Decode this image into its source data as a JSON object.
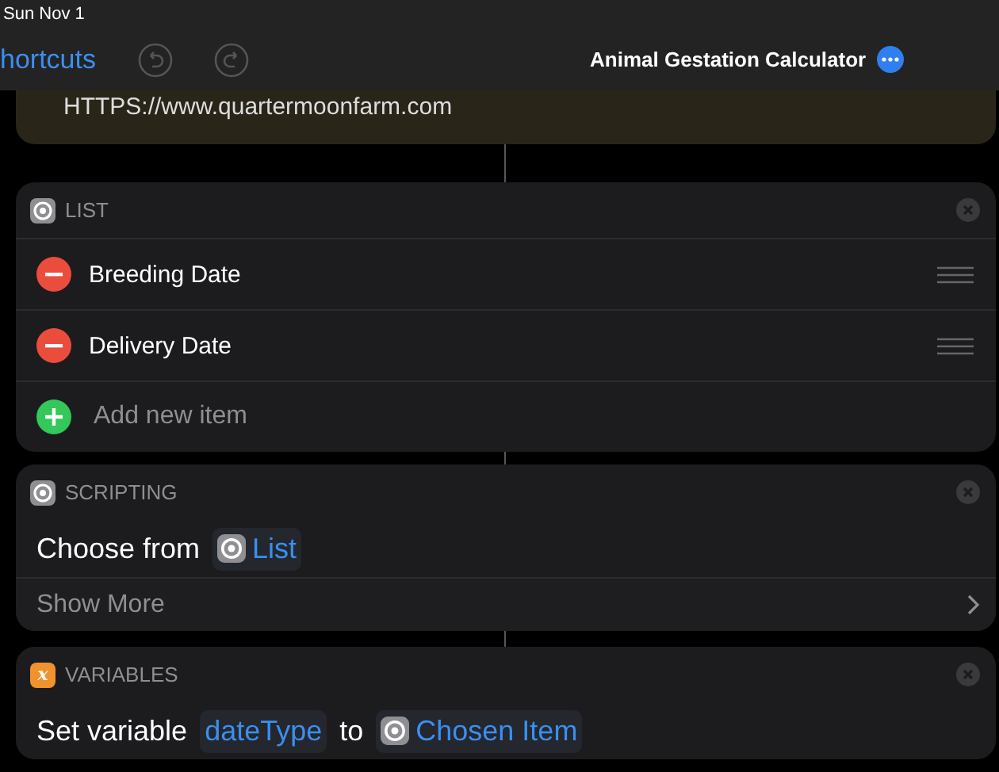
{
  "status_bar": {
    "date": "Sun Nov 1"
  },
  "nav": {
    "back": "hortcuts",
    "title": "Animal Gestation Calculator"
  },
  "actions": [
    {
      "kind": "text",
      "text": "HTTPS://www.quartermoonfarm.com"
    },
    {
      "kind": "list",
      "category": "LIST",
      "badge": {
        "kind": "gear"
      },
      "items": [
        {
          "label": "Breeding Date"
        },
        {
          "label": "Delivery Date"
        }
      ],
      "add_label": "Add new item"
    },
    {
      "kind": "action",
      "category": "SCRIPTING",
      "badge": {
        "kind": "gear"
      },
      "parts": [
        {
          "kind": "text",
          "text": "Choose from"
        },
        {
          "kind": "token",
          "text": "List",
          "with_icon": true
        }
      ],
      "more": "Show More"
    },
    {
      "kind": "action",
      "category": "VARIABLES",
      "badge": {
        "kind": "glyph",
        "text": "x",
        "color": "#f0922e"
      },
      "parts": [
        {
          "kind": "text",
          "text": "Set variable"
        },
        {
          "kind": "token",
          "text": "dateType",
          "with_icon": false
        },
        {
          "kind": "text",
          "text": "to"
        },
        {
          "kind": "token",
          "text": "Chosen Item",
          "with_icon": true
        }
      ]
    }
  ]
}
